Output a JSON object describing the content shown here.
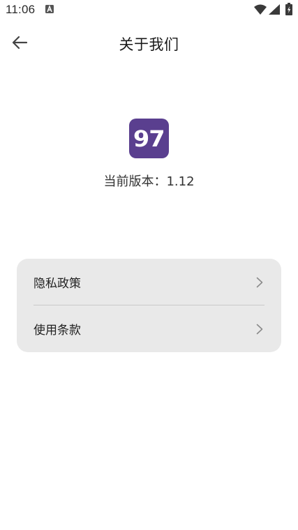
{
  "status_bar": {
    "time": "11:06",
    "notification_icon": "a-letter-icon",
    "wifi_icon": "wifi-icon",
    "signal_icon": "cell-signal-icon",
    "battery_icon": "battery-charging-icon"
  },
  "app_bar": {
    "back_icon": "arrow-left-icon",
    "title": "关于我们"
  },
  "about": {
    "logo_text": "97",
    "logo_color": "#5a3f8f",
    "version_text": "当前版本：1.12"
  },
  "menu": {
    "items": [
      {
        "label": "隐私政策",
        "icon": "chevron-right-icon"
      },
      {
        "label": "使用条款",
        "icon": "chevron-right-icon"
      }
    ]
  }
}
